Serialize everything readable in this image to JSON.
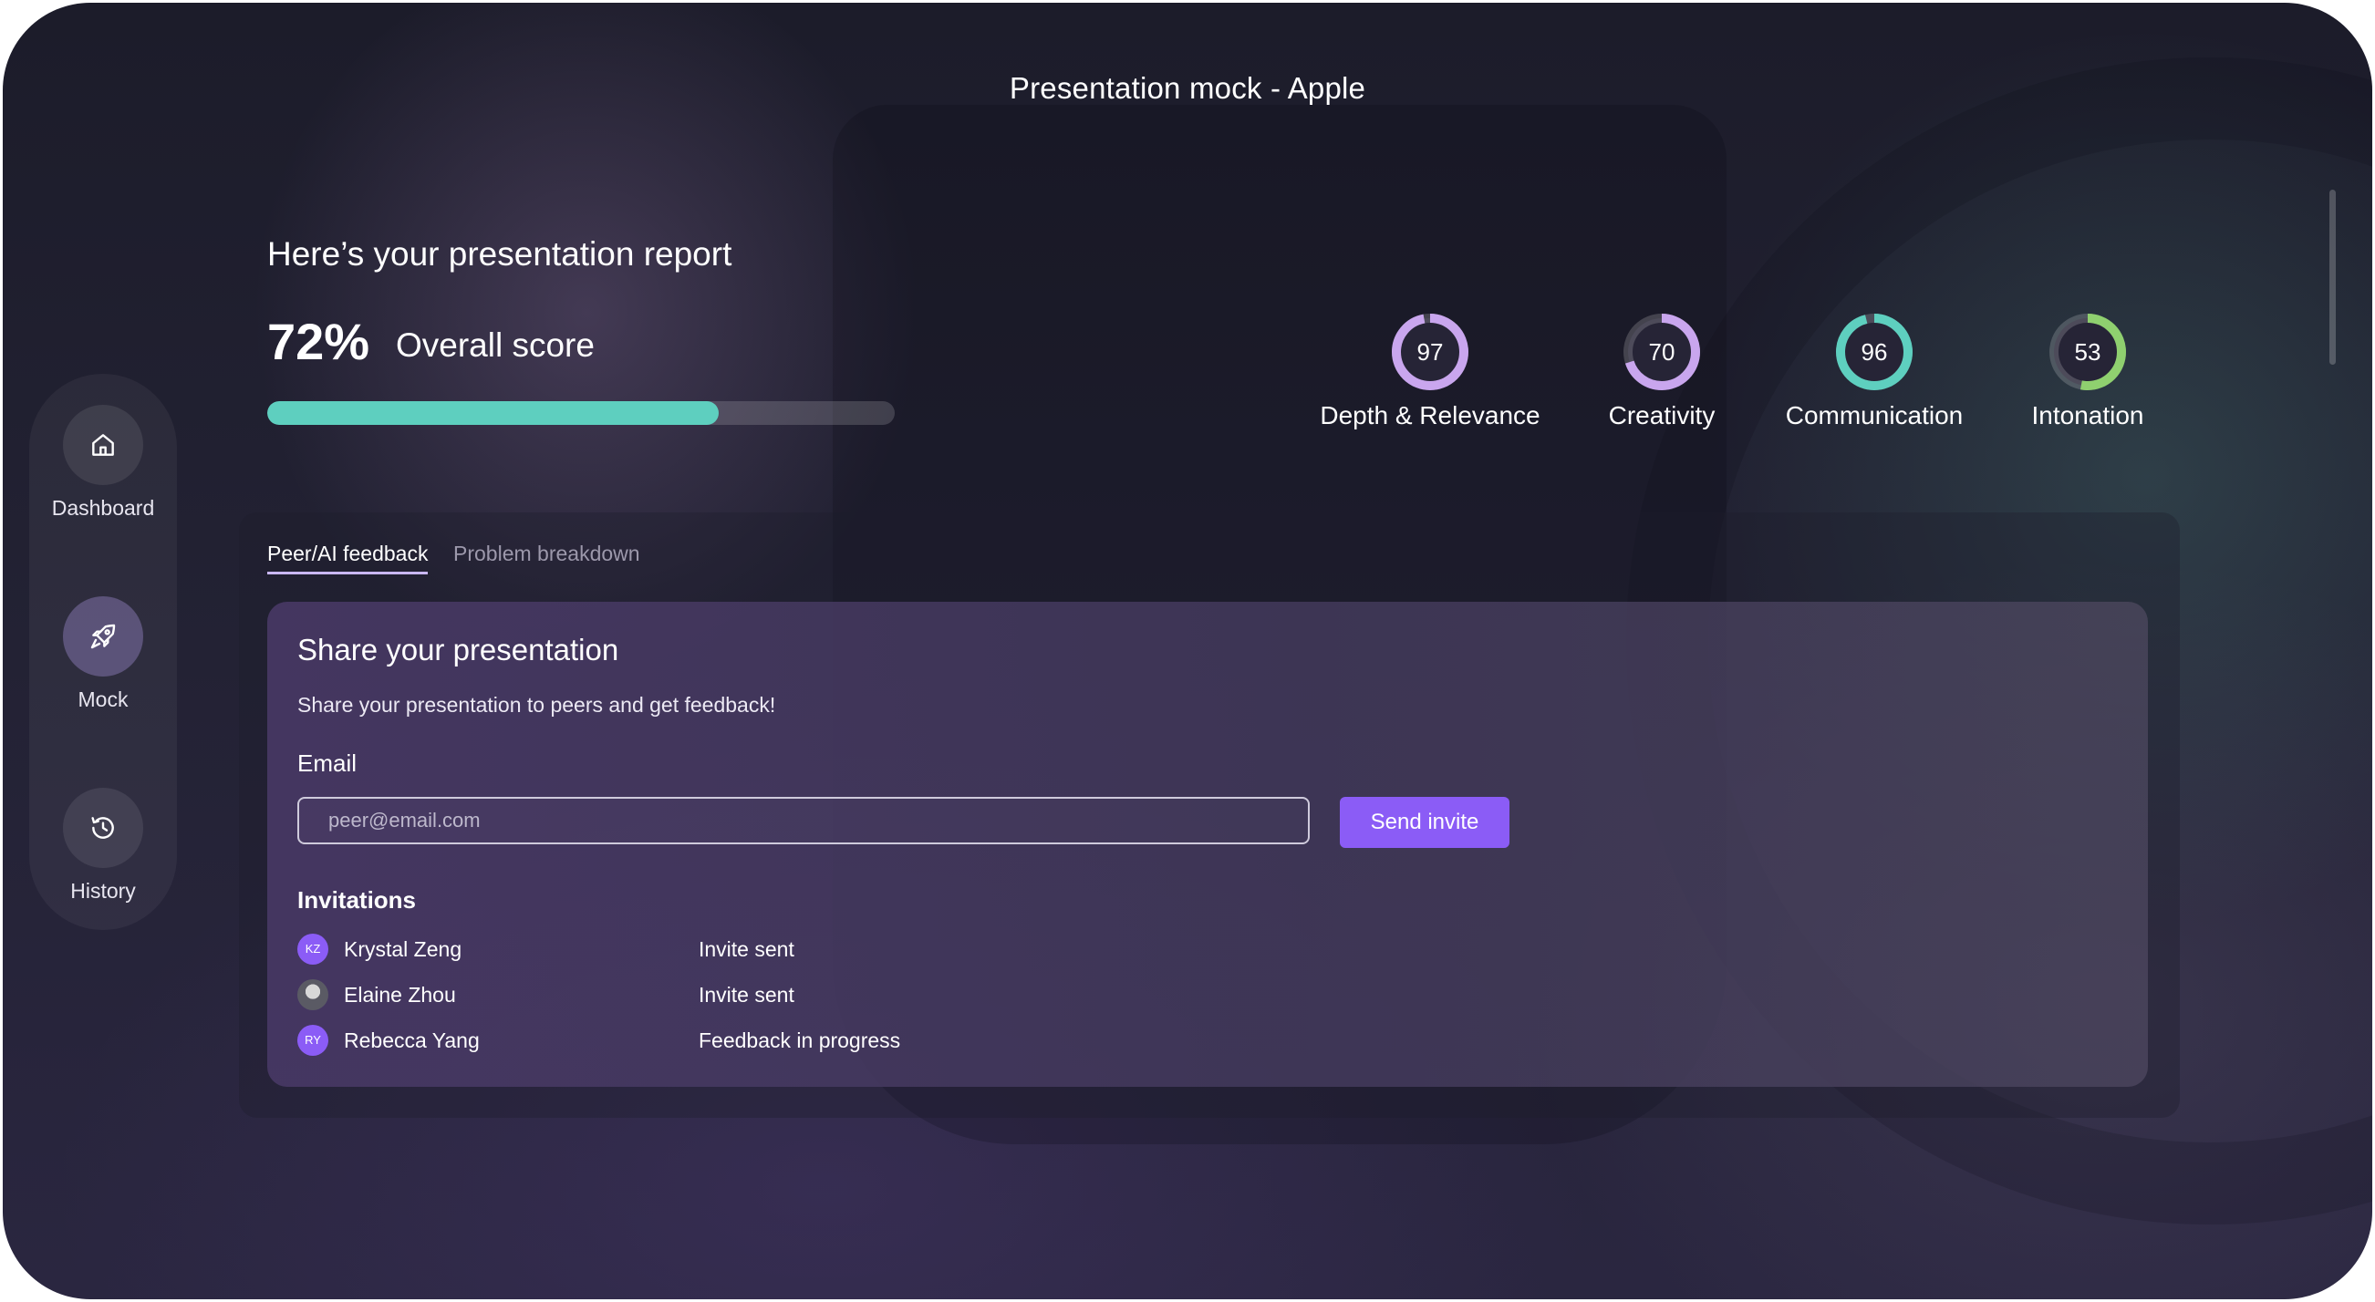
{
  "title": "Presentation mock - Apple",
  "sidebar": {
    "items": [
      {
        "label": "Dashboard",
        "icon": "home-icon",
        "active": false
      },
      {
        "label": "Mock",
        "icon": "rocket-icon",
        "active": true
      },
      {
        "label": "History",
        "icon": "history-icon",
        "active": false
      }
    ]
  },
  "report": {
    "heading": "Here’s your presentation report",
    "score_value": "72%",
    "score_label": "Overall score",
    "progress": 0.72,
    "progress_color": "#5ecfbf",
    "metrics": [
      {
        "value": "97",
        "label": "Depth & Relevance",
        "fraction": 0.97,
        "color": "#c9a6ee"
      },
      {
        "value": "70",
        "label": "Creativity",
        "fraction": 0.7,
        "color": "#c9a6ee"
      },
      {
        "value": "96",
        "label": "Communication",
        "fraction": 0.96,
        "color": "#5ecfbf"
      },
      {
        "value": "53",
        "label": "Intonation",
        "fraction": 0.53,
        "color": "#8fd06f"
      }
    ]
  },
  "tabs": [
    {
      "label": "Peer/AI feedback",
      "active": true
    },
    {
      "label": "Problem breakdown",
      "active": false
    }
  ],
  "share": {
    "title": "Share your presentation",
    "subtitle": "Share your presentation to peers and get feedback!",
    "email_label": "Email",
    "email_placeholder": "peer@email.com",
    "send_label": "Send invite",
    "accent_color": "#8b5cf6"
  },
  "invitations": {
    "heading": "Invitations",
    "items": [
      {
        "initials": "KZ",
        "name": "Krystal Zeng",
        "status": "Invite sent"
      },
      {
        "initials": "",
        "name": "Elaine Zhou",
        "status": "Invite sent"
      },
      {
        "initials": "RY",
        "name": "Rebecca Yang",
        "status": "Feedback in progress"
      }
    ]
  }
}
